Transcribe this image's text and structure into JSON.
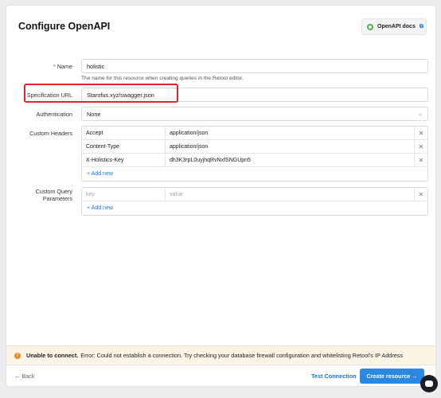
{
  "header": {
    "title": "Configure OpenAPI",
    "docs_label": "OpenAPI docs",
    "docs_external_icon": "⧉"
  },
  "form": {
    "name": {
      "label": "Name",
      "required_mark": "*",
      "value": "holistic",
      "hint": "The name for this resource when creating queries in the Retool editor."
    },
    "spec_url": {
      "label": "Specification URL",
      "value": "Starofus.xyz/swagger.json"
    },
    "authentication": {
      "label": "Authentication",
      "value": "None",
      "chevron": "⌄"
    },
    "custom_headers": {
      "label": "Custom Headers",
      "rows": [
        {
          "key": "Accept",
          "value": "application/json"
        },
        {
          "key": "Content-Type",
          "value": "application/json"
        },
        {
          "key": "X-Holistics-Key",
          "value": "dh3K3rpL0uyjhqRvNxfSNGUpn5"
        }
      ],
      "remove_icon": "✕",
      "add_label": "+ Add new"
    },
    "custom_query_params": {
      "label_line1": "Custom Query",
      "label_line2": "Parameters",
      "key_placeholder": "key",
      "value_placeholder": "value",
      "remove_icon": "✕",
      "add_label": "+ Add new"
    }
  },
  "error": {
    "icon": "!",
    "title": "Unable to connect.",
    "message": "Error: Could not establish a connection. Try checking your database firewall configuration and whitelisting Retool's IP Address"
  },
  "footer": {
    "back_label": "← Back",
    "test_label": "Test Connection",
    "create_label": "Create resource →"
  },
  "colors": {
    "accent": "#2b88e0",
    "highlight": "#e0262f",
    "warning": "#e6892e"
  }
}
